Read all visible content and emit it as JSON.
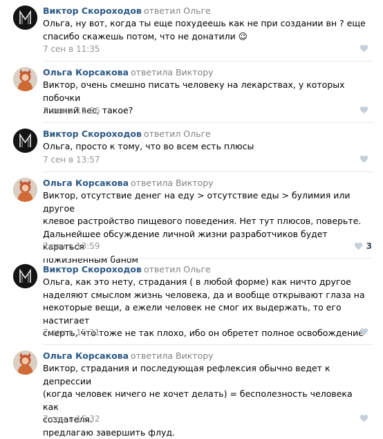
{
  "comments": [
    {
      "author": "Виктор Скороходов",
      "reply_to": "ответил Ольге",
      "text": "Ольга, ну вот, когда ты еще похудеешь как не при создании вн ? еще\nспасибо скажешь потом, что не донатили 😉",
      "date": "7 сен в 11:35",
      "likes": "",
      "avatar": "dark-avatar-icon"
    },
    {
      "author": "Ольга Корсакова",
      "reply_to": "ответила Виктору",
      "text": "Виктор, очень смешно писать человеку на лекарствах, у которых побочки\nлишний вес, такое?",
      "date": "7 сен в 12:06",
      "likes": "",
      "avatar": "photo-avatar-icon"
    },
    {
      "author": "Виктор Скороходов",
      "reply_to": "ответил Ольге",
      "text": "Ольга, просто к тому, что во всем есть плюсы",
      "date": "7 сен в 13:57",
      "likes": "",
      "avatar": "dark-avatar-icon"
    },
    {
      "author": "Ольга Корсакова",
      "reply_to": "ответила Виктору",
      "text": "Виктор, отсутствие денег на еду > отсутствие еды > булимия или другое\nклевое растройство пищевого поведения. Нет тут плюсов, поверьте.\nДальнейшее обсуждение личной жизни разработчиков будет караться\nпожизненным баном",
      "date": "7 сен в 13:59",
      "likes": "3",
      "avatar": "photo-avatar-icon"
    },
    {
      "author": "Виктор Скороходов",
      "reply_to": "ответил Ольге",
      "text": "Ольга, как это нету, страдания ( в любой форме) как ничто другое\nнаделяют смыслом жизнь человека, да и вообще открывают глаза на\nнекоторые вещи, а ежели человек не смог их выдержать, то его настигает\nсмерть, что тоже не так плохо, ибо он обретет полное освобождение",
      "date": "7 сен в 15:31",
      "likes": "",
      "avatar": "dark-avatar-icon"
    },
    {
      "author": "Ольга Корсакова",
      "reply_to": "ответила Виктору",
      "text": "Виктор, страдания и последующая рефлексия обычно ведет к депрессии\n(когда человек ничего не хочет делать) = бесполезность человека как\nсоздателя.\nпредлагаю завершить флуд.",
      "date": "7 сен в 15:32",
      "likes": "",
      "avatar": "photo-avatar-icon"
    }
  ]
}
